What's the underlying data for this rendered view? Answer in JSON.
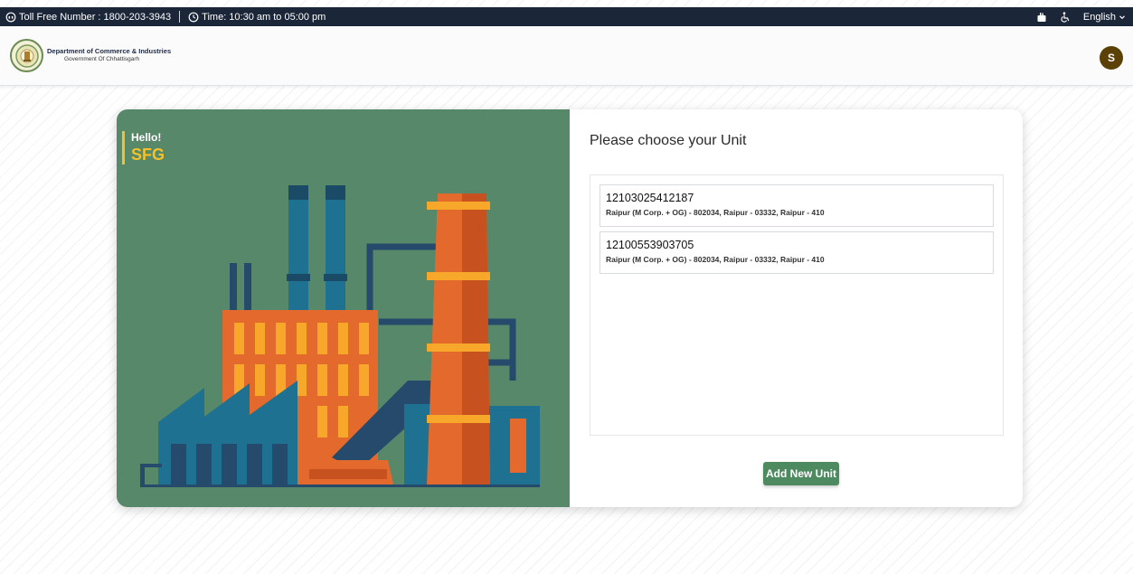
{
  "topbar": {
    "toll_free": "Toll Free Number : 1800-203-3943",
    "time": "Time: 10:30 am to 05:00 pm",
    "language": "English",
    "icons": [
      "phone-icon",
      "clock-icon",
      "sign-language-icon",
      "wheelchair-icon",
      "chevron-down-icon"
    ]
  },
  "header": {
    "department": "Department of Commerce & Industries",
    "government": "Government Of Chhattisgarh",
    "avatar_initial": "S"
  },
  "welcome": {
    "hello": "Hello!",
    "user": "SFG"
  },
  "units_panel": {
    "title": "Please choose your Unit",
    "units": [
      {
        "id": "12103025412187",
        "address": "Raipur (M Corp. + OG) - 802034, Raipur - 03332, Raipur - 410"
      },
      {
        "id": "12100553903705",
        "address": "Raipur (M Corp. + OG) - 802034, Raipur - 03332, Raipur - 410"
      }
    ],
    "add_button": "Add New Unit"
  },
  "colors": {
    "topbar_bg": "#1b2638",
    "panel_green": "#58886a",
    "accent_yellow": "#f3c12b",
    "button_green": "#4e8a60",
    "avatar_brown": "#5c4107"
  }
}
